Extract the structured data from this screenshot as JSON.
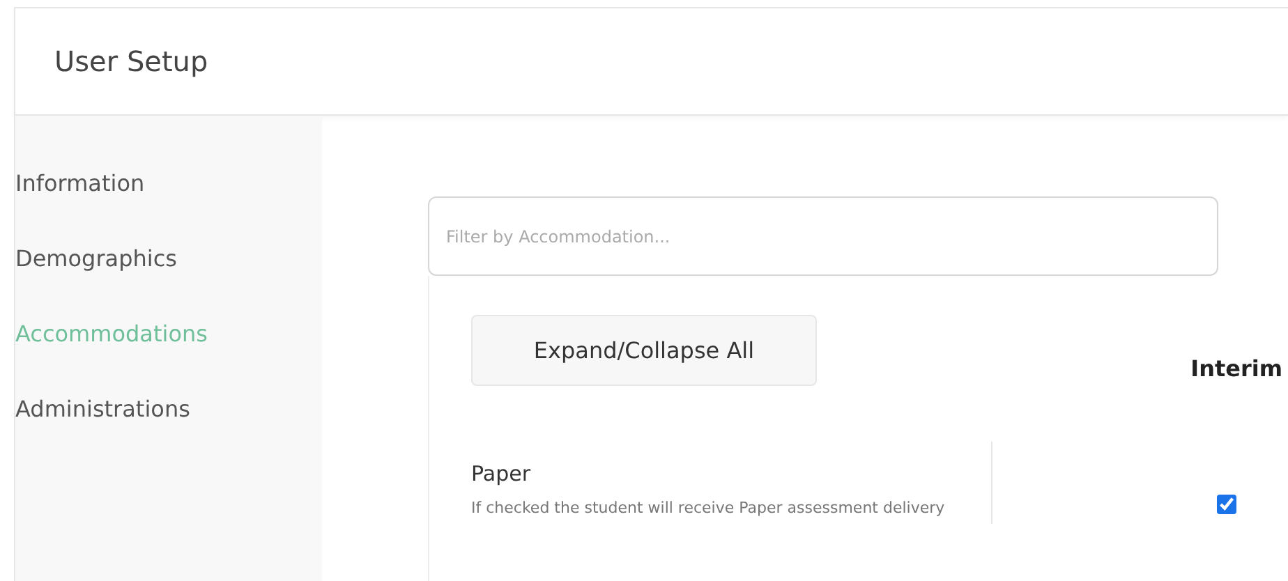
{
  "header": {
    "title": "User Setup"
  },
  "sidebar": {
    "items": [
      {
        "label": "Information",
        "selected": false
      },
      {
        "label": "Demographics",
        "selected": false
      },
      {
        "label": "Accommodations",
        "selected": true
      },
      {
        "label": "Administrations",
        "selected": false
      }
    ]
  },
  "filter": {
    "placeholder": "Filter by Accommodation..."
  },
  "expand_button": "Expand/Collapse All",
  "columns": [
    "Interim"
  ],
  "accommodations": [
    {
      "name": "Paper",
      "description": "If checked the student will receive Paper assessment delivery",
      "interim_checked": true
    }
  ]
}
